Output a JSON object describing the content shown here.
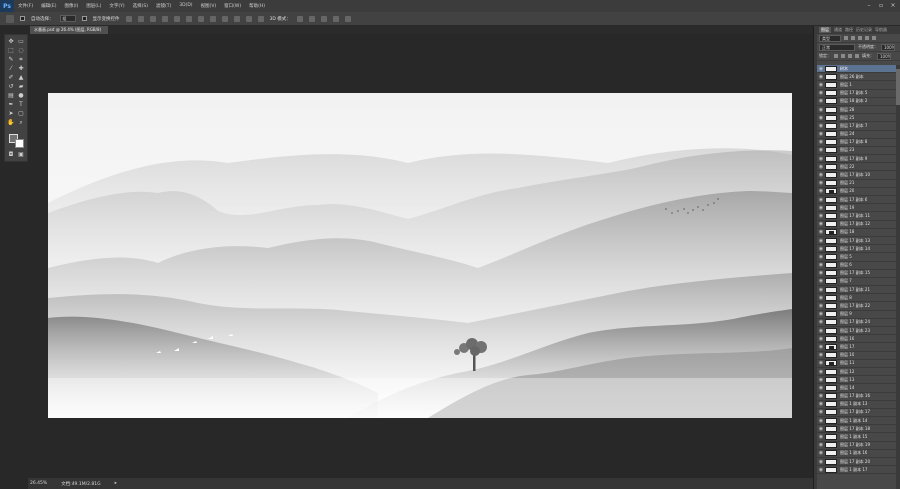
{
  "app": {
    "logo": "Ps"
  },
  "menu": [
    "文件(F)",
    "编辑(E)",
    "图像(I)",
    "图层(L)",
    "文字(Y)",
    "选择(S)",
    "滤镜(T)",
    "3D(D)",
    "视图(V)",
    "窗口(W)",
    "帮助(H)"
  ],
  "options": {
    "auto_select": "自动选择：",
    "auto_select_value": "组",
    "show_transform": "显示变换控件",
    "mode_3d": "3D 模式："
  },
  "document": {
    "tab_label": "水墨画.psd @ 26.4% (图层, RGB/8)"
  },
  "status": {
    "zoom": "26.45%",
    "doc_size": "文档:49.1M/2.81G"
  },
  "panel": {
    "tabs": [
      "图层",
      "通道",
      "路径",
      "历史记录",
      "导航器"
    ],
    "kind_label": "类型",
    "blend_mode": "正常",
    "opacity_label": "不透明度：",
    "opacity": "100%",
    "lock_label": "锁定：",
    "fill_label": "填充：",
    "fill": "100%"
  },
  "layers": [
    {
      "name": "树木",
      "selected": true
    },
    {
      "name": "图层 26 副本"
    },
    {
      "name": "图层 1"
    },
    {
      "name": "图层 17 副本 5"
    },
    {
      "name": "图层 18 副本 2"
    },
    {
      "name": "图层 28"
    },
    {
      "name": "图层 25"
    },
    {
      "name": "图层 17 副本 7"
    },
    {
      "name": "图层 24"
    },
    {
      "name": "图层 17 副本 8"
    },
    {
      "name": "图层 23"
    },
    {
      "name": "图层 17 副本 9"
    },
    {
      "name": "图层 22"
    },
    {
      "name": "图层 17 副本 10"
    },
    {
      "name": "图层 21"
    },
    {
      "name": "图层 20",
      "mark": true
    },
    {
      "name": "图层 17 副本 6"
    },
    {
      "name": "图层 19"
    },
    {
      "name": "图层 17 副本 11"
    },
    {
      "name": "图层 17 副本 12"
    },
    {
      "name": "图层 18",
      "mark": true
    },
    {
      "name": "图层 17 副本 13"
    },
    {
      "name": "图层 17 副本 14"
    },
    {
      "name": "图层 5"
    },
    {
      "name": "图层 6"
    },
    {
      "name": "图层 17 副本 15"
    },
    {
      "name": "图层 7"
    },
    {
      "name": "图层 17 副本 21"
    },
    {
      "name": "图层 8"
    },
    {
      "name": "图层 17 副本 22"
    },
    {
      "name": "图层 9"
    },
    {
      "name": "图层 17 副本 24"
    },
    {
      "name": "图层 17 副本 23"
    },
    {
      "name": "图层 16"
    },
    {
      "name": "图层 17",
      "mark": true
    },
    {
      "name": "图层 10"
    },
    {
      "name": "图层 11",
      "mark": true
    },
    {
      "name": "图层 12"
    },
    {
      "name": "图层 13"
    },
    {
      "name": "图层 14"
    },
    {
      "name": "图层 17 副本 16"
    },
    {
      "name": "图层 1 副本 13"
    },
    {
      "name": "图层 17 副本 17"
    },
    {
      "name": "图层 1 副本 14"
    },
    {
      "name": "图层 17 副本 18"
    },
    {
      "name": "图层 1 副本 15"
    },
    {
      "name": "图层 17 副本 19"
    },
    {
      "name": "图层 1 副本 16"
    },
    {
      "name": "图层 17 副本 20"
    },
    {
      "name": "图层 1 副本 17"
    }
  ],
  "colors": {
    "accent": "#5d7392",
    "canvas_bg": "#f7f7f7",
    "workspace": "#282828"
  }
}
